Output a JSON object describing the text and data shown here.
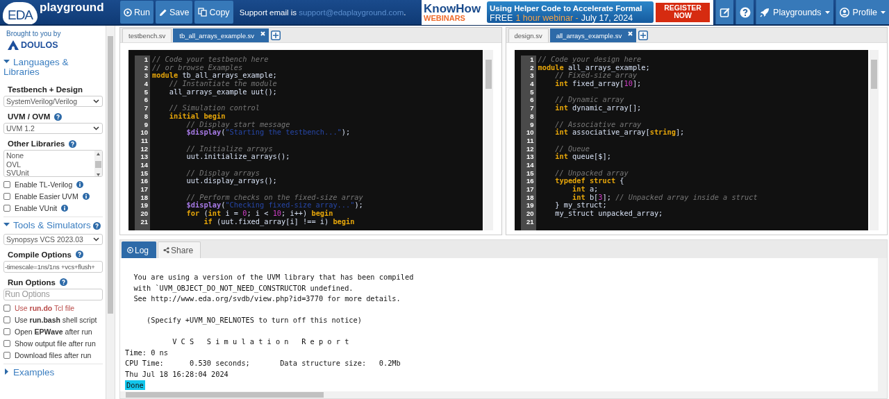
{
  "topbar": {
    "logo": {
      "badge": "EDA",
      "wordmark": "playground"
    },
    "buttons": [
      {
        "kind": "run",
        "label": "Run"
      },
      {
        "kind": "save",
        "label": "Save"
      },
      {
        "kind": "copy",
        "label": "Copy"
      }
    ],
    "support": {
      "text": "Support email is",
      "link": "support@edaplayground.com",
      "after": "."
    },
    "banner": {
      "brand": "KnowHow",
      "brand_sub": "WEBINARS",
      "headline": "Using Helper Code to Accelerate Formal",
      "free": "FREE",
      "duration": "1 hour webinar -",
      "date": "July 17, 2024",
      "cta": "REGISTER NOW"
    },
    "menus": [
      {
        "kind": "edit"
      },
      {
        "kind": "help"
      },
      {
        "kind": "rocket",
        "label": "Playgrounds"
      },
      {
        "kind": "user",
        "label": "Profile"
      }
    ]
  },
  "sidebar": {
    "sponsor": {
      "text": "Brought to you by",
      "logo": "DOULOS"
    },
    "sections": [
      {
        "title": "Languages & Libraries",
        "expanded": true,
        "fields": [
          {
            "kind": "select",
            "label": "Testbench + Design",
            "value": "SystemVerilog/Verilog"
          },
          {
            "kind": "select",
            "label": "UVM / OVM",
            "help": true,
            "value": "UVM 1.2"
          },
          {
            "kind": "listbox",
            "label": "Other Libraries",
            "help": true,
            "options": [
              "None",
              "OVL",
              "SVUnit"
            ]
          },
          {
            "kind": "checkbox",
            "text": "Enable TL-Verilog",
            "checked": false,
            "info": true
          },
          {
            "kind": "checkbox",
            "text": "Enable Easier UVM",
            "checked": false,
            "info": true
          },
          {
            "kind": "checkbox",
            "text": "Enable VUnit",
            "checked": false,
            "info": true
          }
        ]
      },
      {
        "title": "Tools & Simulators",
        "expanded": true,
        "help": true,
        "fields": [
          {
            "kind": "select",
            "value": "Synopsys VCS 2023.03"
          },
          {
            "kind": "input",
            "label": "Compile Options",
            "help": true,
            "value": "-timescale=1ns/1ns +vcs+flush+"
          },
          {
            "kind": "input",
            "label": "Run Options",
            "help": true,
            "placeholder": "Run Options"
          },
          {
            "kind": "checkbox",
            "text": "Use **run.do** Tcl file",
            "checked": false,
            "warning": true
          },
          {
            "kind": "checkbox",
            "text": "Use **run.bash** shell script",
            "checked": false,
            "warning": false
          },
          {
            "kind": "checkbox",
            "text": "Open **EPWave** after run",
            "checked": false,
            "warning": false
          },
          {
            "kind": "checkbox",
            "text": "Show output file after run",
            "checked": false,
            "warning": false
          },
          {
            "kind": "checkbox",
            "text": "Download files after run",
            "checked": false,
            "warning": false
          }
        ]
      },
      {
        "title": "Examples",
        "expanded": false
      }
    ]
  },
  "editors": [
    {
      "tabs": [
        {
          "label": "testbench.sv",
          "selected": false
        },
        {
          "label": "tb_all_arrays_example.sv",
          "selected": true
        }
      ],
      "lines": [
        {
          "number": "1",
          "tokens": [
            {
              "kind": "comment",
              "text": "// Code your testbench here"
            }
          ]
        },
        {
          "number": "2",
          "tokens": [
            {
              "kind": "comment",
              "text": "// or browse Examples"
            }
          ]
        },
        {
          "number": "3",
          "tokens": [
            {
              "kind": "keyword",
              "text": "module"
            },
            {
              "kind": "plain",
              "text": " tb_all_arrays_example;"
            }
          ]
        },
        {
          "number": "4",
          "tokens": [
            {
              "kind": "comment",
              "text": "    // Instantiate the module"
            }
          ]
        },
        {
          "number": "5",
          "tokens": [
            {
              "kind": "plain",
              "text": "    all_arrays_example uut();"
            }
          ]
        },
        {
          "number": "6"
        },
        {
          "number": "7",
          "tokens": [
            {
              "kind": "comment",
              "text": "    // Simulation control"
            }
          ]
        },
        {
          "number": "8",
          "tokens": [
            {
              "kind": "keyword",
              "text": "    initial begin"
            }
          ]
        },
        {
          "number": "9",
          "tokens": [
            {
              "kind": "comment",
              "text": "        // Display start message"
            }
          ]
        },
        {
          "number": "10",
          "tokens": [
            {
              "kind": "system",
              "text": "        $display"
            },
            {
              "kind": "plain",
              "text": "("
            },
            {
              "kind": "string",
              "text": "\"Starting the testbench...\""
            },
            {
              "kind": "plain",
              "text": ");"
            }
          ]
        },
        {
          "number": "11"
        },
        {
          "number": "12",
          "tokens": [
            {
              "kind": "comment",
              "text": "        // Initialize arrays"
            }
          ]
        },
        {
          "number": "13",
          "tokens": [
            {
              "kind": "plain",
              "text": "        uut.initialize_arrays();"
            }
          ]
        },
        {
          "number": "14"
        },
        {
          "number": "15",
          "tokens": [
            {
              "kind": "comment",
              "text": "        // Display arrays"
            }
          ]
        },
        {
          "number": "16",
          "tokens": [
            {
              "kind": "plain",
              "text": "        uut.display_arrays();"
            }
          ]
        },
        {
          "number": "17"
        },
        {
          "number": "18",
          "tokens": [
            {
              "kind": "comment",
              "text": "        // Perform checks on the fixed-size array"
            }
          ]
        },
        {
          "number": "19",
          "tokens": [
            {
              "kind": "system",
              "text": "        $display"
            },
            {
              "kind": "plain",
              "text": "("
            },
            {
              "kind": "string",
              "text": "\"Checking fixed-size array...\""
            },
            {
              "kind": "plain",
              "text": ");"
            }
          ]
        },
        {
          "number": "20",
          "tokens": [
            {
              "kind": "keyword",
              "text": "        for"
            },
            {
              "kind": "plain",
              "text": " ("
            },
            {
              "kind": "keyword",
              "text": "int"
            },
            {
              "kind": "plain",
              "text": " i = "
            },
            {
              "kind": "number",
              "text": "0"
            },
            {
              "kind": "plain",
              "text": "; i < "
            },
            {
              "kind": "number",
              "text": "10"
            },
            {
              "kind": "plain",
              "text": "; i++) "
            },
            {
              "kind": "keyword",
              "text": "begin"
            }
          ]
        },
        {
          "number": "21",
          "tokens": [
            {
              "kind": "keyword",
              "text": "            if"
            },
            {
              "kind": "plain",
              "text": " (uut.fixed_array[i] !== i) "
            },
            {
              "kind": "keyword",
              "text": "begin"
            }
          ]
        }
      ]
    },
    {
      "tabs": [
        {
          "label": "design.sv",
          "selected": false
        },
        {
          "label": "all_arrays_example.sv",
          "selected": true
        }
      ],
      "lines": [
        {
          "number": "1",
          "tokens": [
            {
              "kind": "comment",
              "text": "// Code your design here"
            }
          ]
        },
        {
          "number": "2",
          "tokens": [
            {
              "kind": "keyword",
              "text": "module"
            },
            {
              "kind": "plain",
              "text": " all_arrays_example;"
            }
          ]
        },
        {
          "number": "3",
          "tokens": [
            {
              "kind": "comment",
              "text": "    // Fixed-size array"
            }
          ]
        },
        {
          "number": "4",
          "tokens": [
            {
              "kind": "keyword",
              "text": "    int"
            },
            {
              "kind": "plain",
              "text": " fixed_array["
            },
            {
              "kind": "number",
              "text": "10"
            },
            {
              "kind": "plain",
              "text": "];"
            }
          ]
        },
        {
          "number": "5"
        },
        {
          "number": "6",
          "tokens": [
            {
              "kind": "comment",
              "text": "    // Dynamic array"
            }
          ]
        },
        {
          "number": "7",
          "tokens": [
            {
              "kind": "keyword",
              "text": "    int"
            },
            {
              "kind": "plain",
              "text": " dynamic_array[];"
            }
          ]
        },
        {
          "number": "8"
        },
        {
          "number": "9",
          "tokens": [
            {
              "kind": "comment",
              "text": "    // Associative array"
            }
          ]
        },
        {
          "number": "10",
          "tokens": [
            {
              "kind": "keyword",
              "text": "    int"
            },
            {
              "kind": "plain",
              "text": " associative_array["
            },
            {
              "kind": "keyword",
              "text": "string"
            },
            {
              "kind": "plain",
              "text": "];"
            }
          ]
        },
        {
          "number": "11"
        },
        {
          "number": "12",
          "tokens": [
            {
              "kind": "comment",
              "text": "    // Queue"
            }
          ]
        },
        {
          "number": "13",
          "tokens": [
            {
              "kind": "keyword",
              "text": "    int"
            },
            {
              "kind": "plain",
              "text": " queue[$];"
            }
          ]
        },
        {
          "number": "14"
        },
        {
          "number": "15",
          "tokens": [
            {
              "kind": "comment",
              "text": "    // Unpacked array"
            }
          ]
        },
        {
          "number": "16",
          "tokens": [
            {
              "kind": "keyword",
              "text": "    typedef struct"
            },
            {
              "kind": "plain",
              "text": " {"
            }
          ]
        },
        {
          "number": "17",
          "tokens": [
            {
              "kind": "keyword",
              "text": "        int"
            },
            {
              "kind": "plain",
              "text": " a;"
            }
          ]
        },
        {
          "number": "18",
          "tokens": [
            {
              "kind": "keyword",
              "text": "        int"
            },
            {
              "kind": "plain",
              "text": " b["
            },
            {
              "kind": "number",
              "text": "3"
            },
            {
              "kind": "plain",
              "text": "]; "
            },
            {
              "kind": "comment",
              "text": "// Unpacked array inside a struct"
            }
          ]
        },
        {
          "number": "19",
          "tokens": [
            {
              "kind": "plain",
              "text": "    } my_struct;"
            }
          ]
        },
        {
          "number": "20",
          "tokens": [
            {
              "kind": "plain",
              "text": "    my_struct unpacked_array;"
            }
          ]
        },
        {
          "number": "21"
        }
      ]
    }
  ],
  "output": {
    "tabs": [
      {
        "kind": "log",
        "label": "Log",
        "selected": true
      },
      {
        "kind": "share",
        "label": "Share",
        "selected": false
      }
    ],
    "blocks": [
      [
        "  You are using a version of the UVM library that has been compiled",
        "  with `UVM_OBJECT_DO_NOT_NEED_CONSTRUCTOR undefined.",
        "  See http://www.eda.org/svdb/view.php?id=3770 for more details."
      ],
      [
        "     (Specify +UVM_NO_RELNOTES to turn off this notice)"
      ],
      [
        "           V C S   S i m u l a t i o n   R e p o r t",
        "Time: 0 ns",
        "CPU Time:      0.530 seconds;       Data structure size:   0.2Mb",
        "Thu Jul 18 16:28:04 2024"
      ]
    ],
    "status": "Done"
  }
}
